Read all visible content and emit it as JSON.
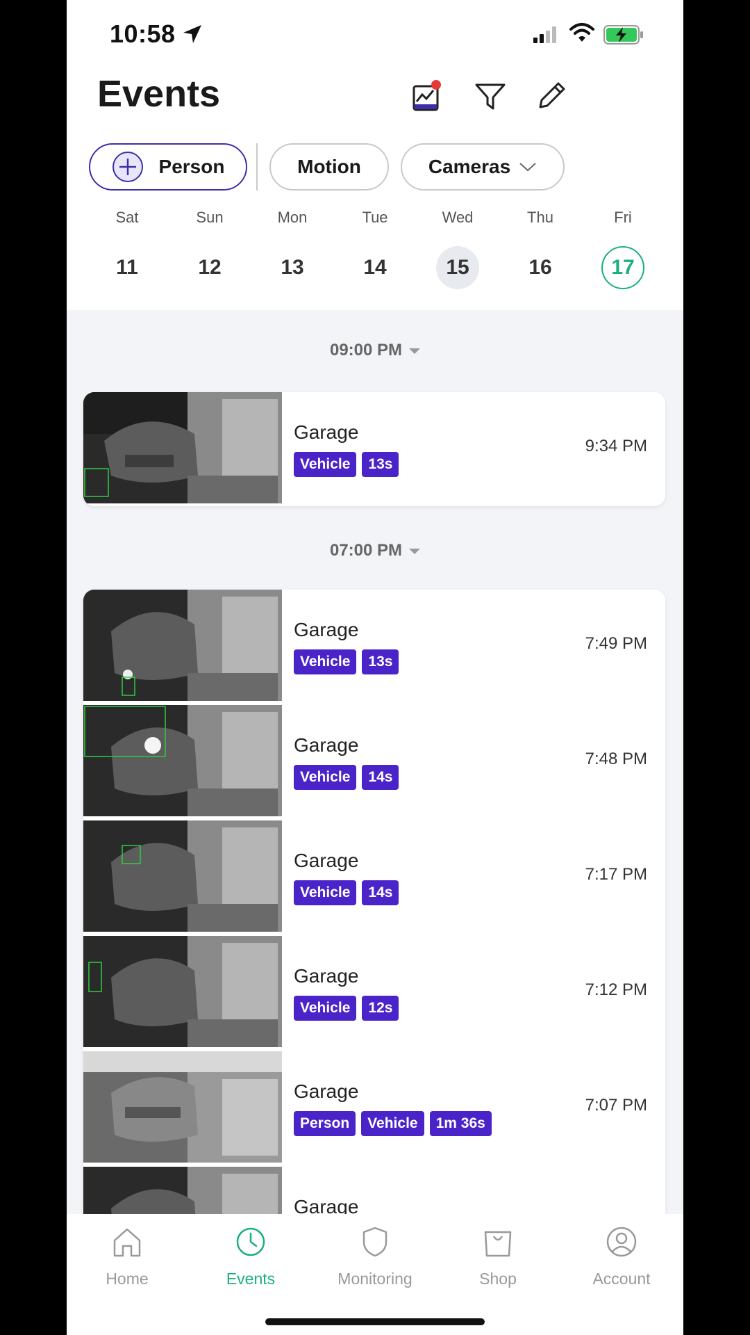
{
  "status_bar": {
    "time": "10:58"
  },
  "header": {
    "title": "Events"
  },
  "filters": {
    "person": "Person",
    "motion": "Motion",
    "cameras": "Cameras"
  },
  "days": [
    {
      "name": "Sat",
      "date": "11"
    },
    {
      "name": "Sun",
      "date": "12"
    },
    {
      "name": "Mon",
      "date": "13"
    },
    {
      "name": "Tue",
      "date": "14"
    },
    {
      "name": "Wed",
      "date": "15"
    },
    {
      "name": "Thu",
      "date": "16"
    },
    {
      "name": "Fri",
      "date": "17"
    }
  ],
  "groups": [
    {
      "header": "09:00 PM",
      "events": [
        {
          "camera": "Garage",
          "tags": [
            "Vehicle",
            "13s"
          ],
          "time": "9:34 PM"
        }
      ]
    },
    {
      "header": "07:00 PM",
      "events": [
        {
          "camera": "Garage",
          "tags": [
            "Vehicle",
            "13s"
          ],
          "time": "7:49 PM"
        },
        {
          "camera": "Garage",
          "tags": [
            "Vehicle",
            "14s"
          ],
          "time": "7:48 PM"
        },
        {
          "camera": "Garage",
          "tags": [
            "Vehicle",
            "14s"
          ],
          "time": "7:17 PM"
        },
        {
          "camera": "Garage",
          "tags": [
            "Vehicle",
            "12s"
          ],
          "time": "7:12 PM"
        },
        {
          "camera": "Garage",
          "tags": [
            "Person",
            "Vehicle",
            "1m 36s"
          ],
          "time": "7:07 PM"
        },
        {
          "camera": "Garage",
          "tags": [],
          "time": ""
        }
      ]
    }
  ],
  "tabbar": {
    "home": "Home",
    "events": "Events",
    "monitoring": "Monitoring",
    "shop": "Shop",
    "account": "Account"
  },
  "colors": {
    "accent_green": "#1ab07e",
    "tag_purple": "#4a24c9",
    "notification_red": "#e53935"
  }
}
